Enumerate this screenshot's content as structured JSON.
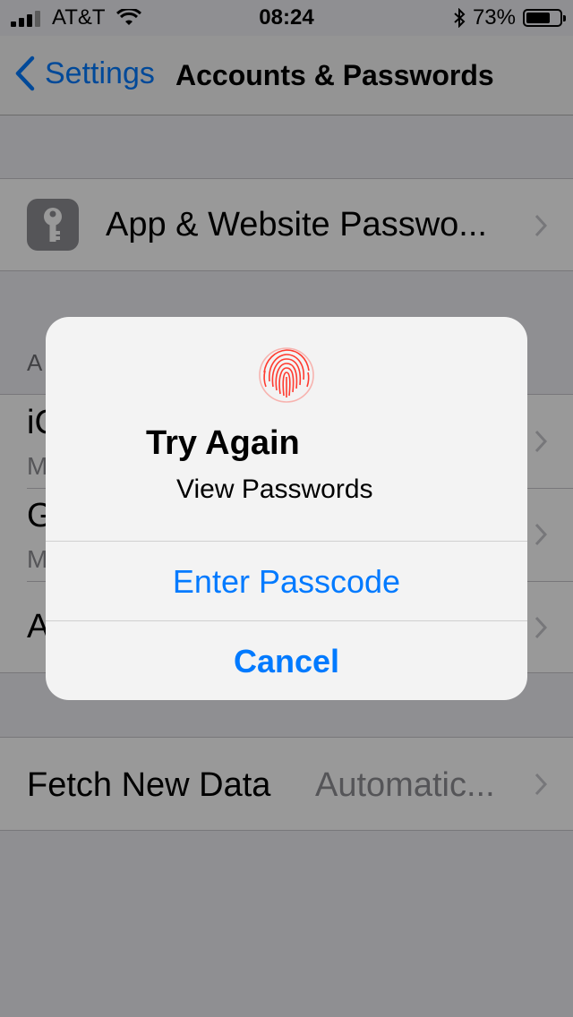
{
  "status_bar": {
    "carrier": "AT&T",
    "time": "08:24",
    "battery_percent": "73%",
    "battery_level": 0.73,
    "signal_icon": "signal-bars-icon",
    "wifi_icon": "wifi-icon",
    "bluetooth_icon": "bluetooth-icon"
  },
  "nav": {
    "back_label": "Settings",
    "title": "Accounts & Passwords"
  },
  "passwords_row": {
    "label": "App & Website Passwo...",
    "icon": "key-icon"
  },
  "accounts": {
    "header_partial": "A",
    "items": [
      {
        "title_partial": "iC",
        "subtitle_partial": "M"
      },
      {
        "title_partial": "G",
        "subtitle_partial": "M"
      },
      {
        "title_partial": "A"
      }
    ]
  },
  "fetch_row": {
    "label": "Fetch New Data",
    "value": "Automatic..."
  },
  "alert": {
    "icon": "fingerprint-icon",
    "title": "Try Again",
    "message": "View Passwords",
    "buttons": {
      "enter_passcode": "Enter Passcode",
      "cancel": "Cancel"
    }
  },
  "colors": {
    "accent": "#007aff",
    "fingerprint": "#ff3b30"
  }
}
